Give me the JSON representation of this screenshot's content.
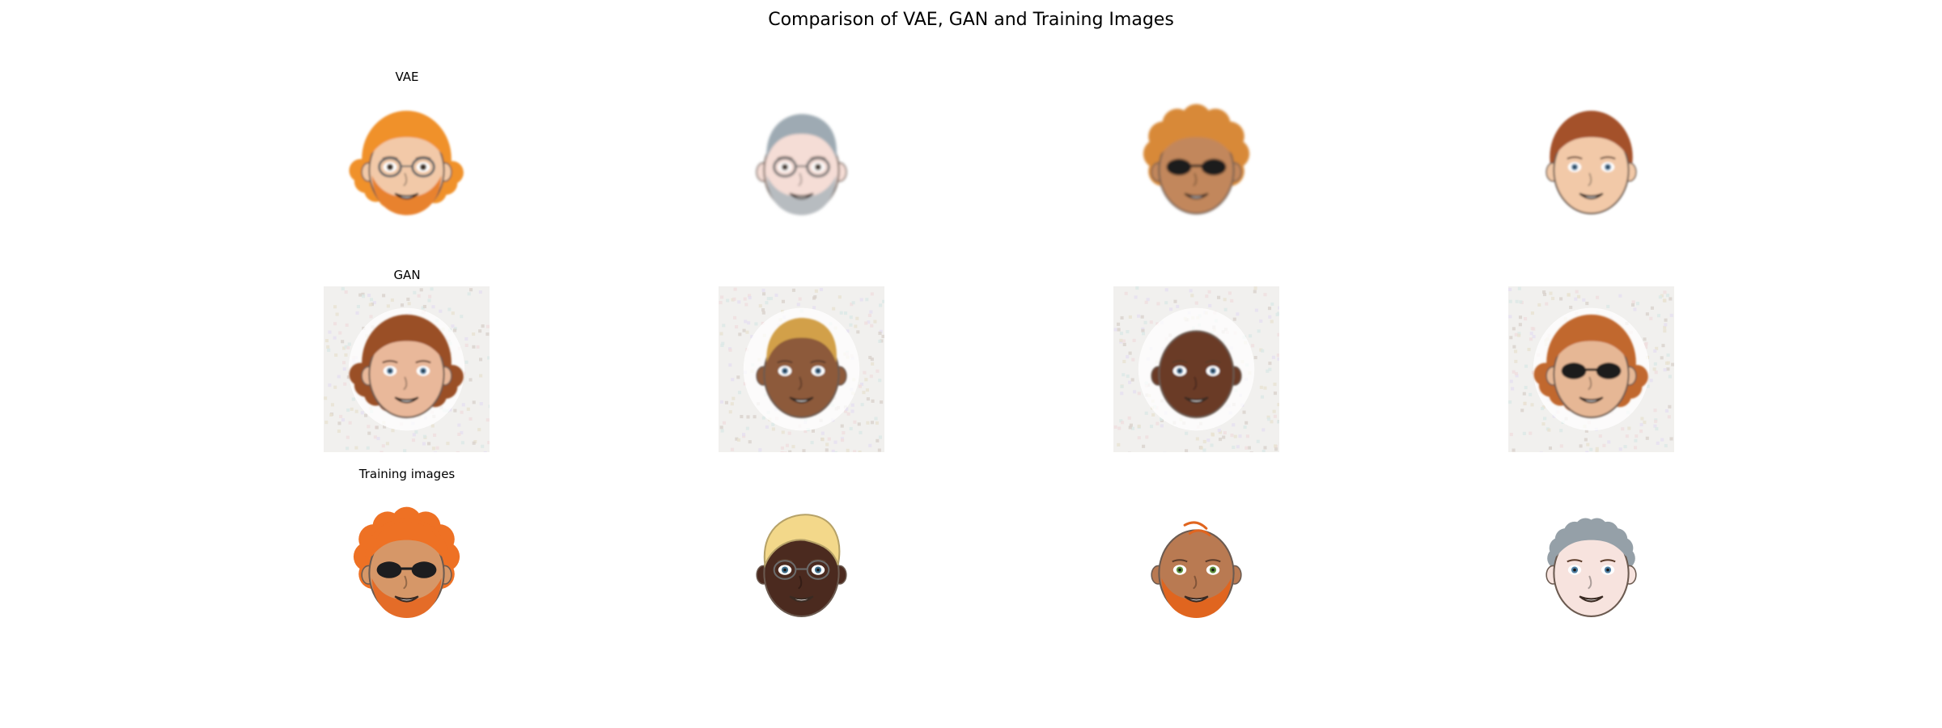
{
  "figure": {
    "title": "Comparison of VAE, GAN and Training Images"
  },
  "rows": [
    {
      "label": "VAE",
      "kind": "vae",
      "faces": [
        {
          "skin": "#f2c9a8",
          "hair": "#f0912a",
          "hair_style": "curly-long",
          "eyes": "glasses",
          "beard": "#e8822f",
          "blur": 1.4
        },
        {
          "skin": "#f5ddd6",
          "hair": "#9eaab3",
          "hair_style": "short",
          "eyes": "glasses",
          "beard": "#b7bcc0",
          "blur": 1.6
        },
        {
          "skin": "#c2875c",
          "hair": "#d88938",
          "hair_style": "curly-big",
          "eyes": "sunglasses",
          "beard": null,
          "blur": 1.6
        },
        {
          "skin": "#f2c9a8",
          "hair": "#a4512c",
          "hair_style": "medium",
          "eyes": "open",
          "beard": null,
          "blur": 1.4
        }
      ]
    },
    {
      "label": "GAN",
      "kind": "gan",
      "faces": [
        {
          "skin": "#e9b89a",
          "hair": "#9a4f27",
          "hair_style": "curly-long",
          "eyes": "open",
          "beard": null,
          "blur": 1.0
        },
        {
          "skin": "#8d5a3b",
          "hair": "#d2a048",
          "hair_style": "short",
          "eyes": "open",
          "beard": null,
          "blur": 1.0
        },
        {
          "skin": "#6b3a26",
          "hair": "#5a2f1f",
          "hair_style": "bald",
          "eyes": "open",
          "beard": null,
          "blur": 1.0
        },
        {
          "skin": "#e6b795",
          "hair": "#c1682e",
          "hair_style": "curly-long",
          "eyes": "sunglasses",
          "beard": null,
          "blur": 1.0
        }
      ]
    },
    {
      "label": "Training images",
      "kind": "train",
      "faces": [
        {
          "skin": "#d69768",
          "hair": "#ee7124",
          "hair_style": "curly-big",
          "eyes": "sunglasses",
          "beard": "#e46c28",
          "blur": 0
        },
        {
          "skin": "#4b2a1f",
          "hair": "#f3d88a",
          "hair_style": "swoop",
          "eyes": "glasses-thin",
          "beard": null,
          "blur": 0
        },
        {
          "skin": "#b97a52",
          "hair": "#e0651f",
          "hair_style": "bald-lines",
          "eyes": "open-green",
          "beard": "#e0651f",
          "blur": 0
        },
        {
          "skin": "#f7e3de",
          "hair": "#95a0a8",
          "hair_style": "curly-short",
          "eyes": "open",
          "beard": null,
          "blur": 0
        }
      ]
    }
  ]
}
